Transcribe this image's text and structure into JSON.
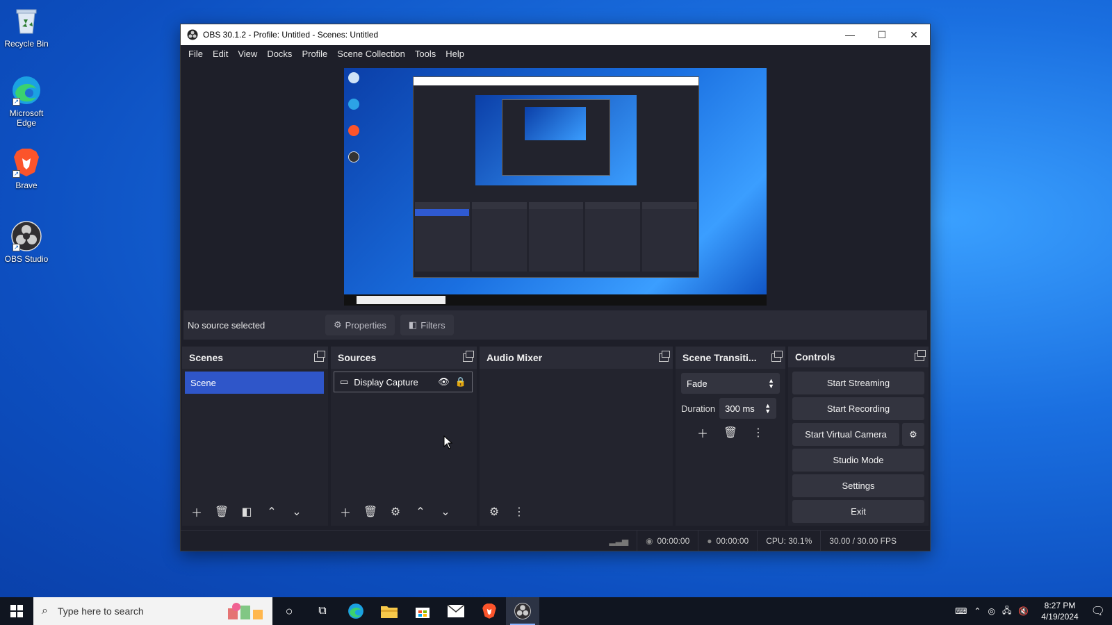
{
  "desktop": {
    "icons": [
      {
        "label": "Recycle Bin"
      },
      {
        "label": "Microsoft Edge"
      },
      {
        "label": "Brave"
      },
      {
        "label": "OBS Studio"
      }
    ]
  },
  "window": {
    "title": "OBS 30.1.2 - Profile: Untitled - Scenes: Untitled",
    "controls": {
      "minimize": "—",
      "maximize": "☐",
      "close": "✕"
    }
  },
  "menu": [
    "File",
    "Edit",
    "View",
    "Docks",
    "Profile",
    "Scene Collection",
    "Tools",
    "Help"
  ],
  "source_toolbar": {
    "status": "No source selected",
    "properties_label": "Properties",
    "filters_label": "Filters"
  },
  "docks": {
    "scenes": {
      "title": "Scenes",
      "items": [
        "Scene"
      ]
    },
    "sources": {
      "title": "Sources",
      "items": [
        "Display Capture"
      ]
    },
    "audio_mixer": {
      "title": "Audio Mixer"
    },
    "transitions": {
      "title": "Scene Transiti...",
      "selected": "Fade",
      "duration_label": "Duration",
      "duration_value": "300 ms"
    },
    "controls": {
      "title": "Controls",
      "start_streaming": "Start Streaming",
      "start_recording": "Start Recording",
      "start_virtual_camera": "Start Virtual Camera",
      "studio_mode": "Studio Mode",
      "settings": "Settings",
      "exit": "Exit"
    }
  },
  "status": {
    "stream_time": "00:00:00",
    "record_time": "00:00:00",
    "cpu": "CPU: 30.1%",
    "fps": "30.00 / 30.00 FPS"
  },
  "taskbar": {
    "search_placeholder": "Type here to search",
    "time": "8:27 PM",
    "date": "4/19/2024"
  },
  "colors": {
    "accent": "#2f56c9",
    "window_bg": "#1e1f29",
    "dock_bg": "#272833"
  }
}
